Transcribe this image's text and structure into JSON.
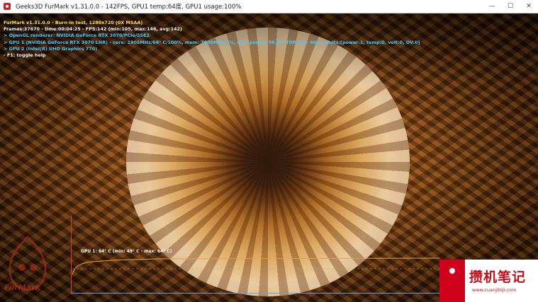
{
  "window": {
    "title": "Geeks3D FurMark v1.31.0.0 - 142FPS, GPU1 temp:64度, GPU1 usage:100%",
    "minimize_glyph": "—",
    "maximize_glyph": "☐",
    "close_glyph": "✕"
  },
  "hud": {
    "line1": "FurMark v1.31.0.0 - Burn-in test, 1280x720 (0X MSAA)",
    "line2": "Frames:37670 - time:00:04:25 - FPS:142 (min:105, max:146, avg:142)",
    "line3": "> OpenGL renderer: NVIDIA GeForce RTX 3070/PCIe/SSE2",
    "line4": "> GPU 1 (NVIDIA GeForce RTX 3070 LHR) - core: 1905MHz/64° C/100%, mem: 7000MHz/7%, GPU power: 98.0% TDP, fan: 60%, limits:[power:1, temp:0, volt:0, OV:0]",
    "line5": "> GPU 2 (Intel(R) UHD Graphics 770)",
    "line6": "- F1: toggle help"
  },
  "graph": {
    "label": "GPU 1: 64° C (min: 49° C - max: 64° C)"
  },
  "logo": {
    "text": "FurMark"
  },
  "watermark": {
    "main": "攒机笔记",
    "sub": "www.cuanjibiji.com"
  },
  "colors": {
    "hud_yellow": "#ffe14a",
    "hud_cyan": "#48c8ff",
    "graph_line": "#e8a040",
    "watermark_red": "#c0101e"
  }
}
